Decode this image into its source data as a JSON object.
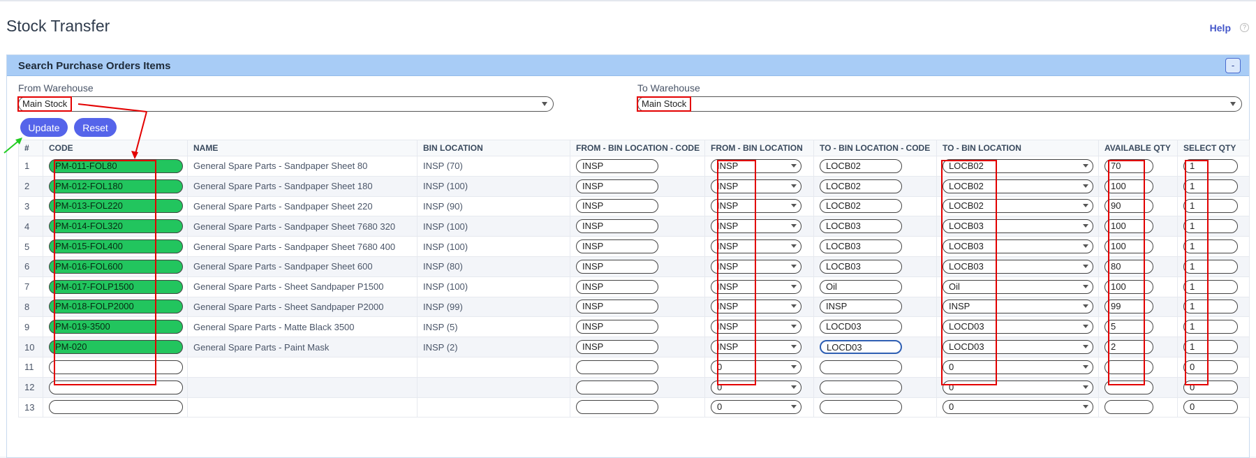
{
  "page": {
    "title": "Stock Transfer",
    "help_label": "Help",
    "help_icon": "question-icon"
  },
  "panel": {
    "title": "Search Purchase Orders Items",
    "collapse_label": "-"
  },
  "filters": {
    "from_label": "From Warehouse",
    "from_value": "Main Stock",
    "to_label": "To Warehouse",
    "to_value": "Main Stock"
  },
  "buttons": {
    "update": "Update",
    "reset": "Reset"
  },
  "columns": [
    "#",
    "CODE",
    "NAME",
    "BIN LOCATION",
    "FROM - BIN LOCATION - CODE",
    "FROM - BIN LOCATION",
    "TO - BIN LOCATION - CODE",
    "TO - BIN LOCATION",
    "AVAILABLE QTY",
    "SELECT QTY"
  ],
  "rows": [
    {
      "num": "1",
      "code": "PM-011-FOL80",
      "name": "General Spare Parts - Sandpaper Sheet 80",
      "bin": "INSP (70)",
      "from_code": "INSP",
      "from_bin": "INSP",
      "to_code": "LOCB02",
      "to_bin": "LOCB02",
      "avail": "70",
      "sel": "1"
    },
    {
      "num": "2",
      "code": "PM-012-FOL180",
      "name": "General Spare Parts - Sandpaper Sheet 180",
      "bin": "INSP (100)",
      "from_code": "INSP",
      "from_bin": "INSP",
      "to_code": "LOCB02",
      "to_bin": "LOCB02",
      "avail": "100",
      "sel": "1"
    },
    {
      "num": "3",
      "code": "PM-013-FOL220",
      "name": "General Spare Parts - Sandpaper Sheet 220",
      "bin": "INSP (90)",
      "from_code": "INSP",
      "from_bin": "INSP",
      "to_code": "LOCB02",
      "to_bin": "LOCB02",
      "avail": "90",
      "sel": "1"
    },
    {
      "num": "4",
      "code": "PM-014-FOL320",
      "name": "General Spare Parts - Sandpaper Sheet 7680 320",
      "bin": "INSP (100)",
      "from_code": "INSP",
      "from_bin": "INSP",
      "to_code": "LOCB03",
      "to_bin": "LOCB03",
      "avail": "100",
      "sel": "1"
    },
    {
      "num": "5",
      "code": "PM-015-FOL400",
      "name": "General Spare Parts - Sandpaper Sheet 7680 400",
      "bin": "INSP (100)",
      "from_code": "INSP",
      "from_bin": "INSP",
      "to_code": "LOCB03",
      "to_bin": "LOCB03",
      "avail": "100",
      "sel": "1"
    },
    {
      "num": "6",
      "code": "PM-016-FOL600",
      "name": "General Spare Parts - Sandpaper Sheet 600",
      "bin": "INSP (80)",
      "from_code": "INSP",
      "from_bin": "INSP",
      "to_code": "LOCB03",
      "to_bin": "LOCB03",
      "avail": "80",
      "sel": "1"
    },
    {
      "num": "7",
      "code": "PM-017-FOLP1500",
      "name": "General Spare Parts - Sheet Sandpaper P1500",
      "bin": "INSP (100)",
      "from_code": "INSP",
      "from_bin": "INSP",
      "to_code": "Oil",
      "to_bin": "Oil",
      "avail": "100",
      "sel": "1"
    },
    {
      "num": "8",
      "code": "PM-018-FOLP2000",
      "name": "General Spare Parts - Sheet Sandpaper P2000",
      "bin": "INSP (99)",
      "from_code": "INSP",
      "from_bin": "INSP",
      "to_code": "INSP",
      "to_bin": "INSP",
      "avail": "99",
      "sel": "1"
    },
    {
      "num": "9",
      "code": "PM-019-3500",
      "name": "General Spare Parts - Matte Black 3500",
      "bin": "INSP (5)",
      "from_code": "INSP",
      "from_bin": "INSP",
      "to_code": "LOCD03",
      "to_bin": "LOCD03",
      "avail": "5",
      "sel": "1"
    },
    {
      "num": "10",
      "code": "PM-020",
      "name": "General Spare Parts - Paint Mask",
      "bin": "INSP (2)",
      "from_code": "INSP",
      "from_bin": "INSP",
      "to_code": "LOCD03",
      "to_bin": "LOCD03",
      "avail": "2",
      "sel": "1"
    },
    {
      "num": "11",
      "code": "",
      "name": "",
      "bin": "",
      "from_code": "",
      "from_bin": "0",
      "to_code": "",
      "to_bin": "0",
      "avail": "",
      "sel": "0"
    },
    {
      "num": "12",
      "code": "",
      "name": "",
      "bin": "",
      "from_code": "",
      "from_bin": "0",
      "to_code": "",
      "to_bin": "0",
      "avail": "",
      "sel": "0"
    },
    {
      "num": "13",
      "code": "",
      "name": "",
      "bin": "",
      "from_code": "",
      "from_bin": "0",
      "to_code": "",
      "to_bin": "0",
      "avail": "",
      "sel": "0"
    }
  ],
  "colors": {
    "header_bar": "#a8ccf6",
    "button": "#5564ea",
    "code_fill": "#22c55e",
    "annotation": "#e30000",
    "pointer_arrow": "#22cc22"
  }
}
